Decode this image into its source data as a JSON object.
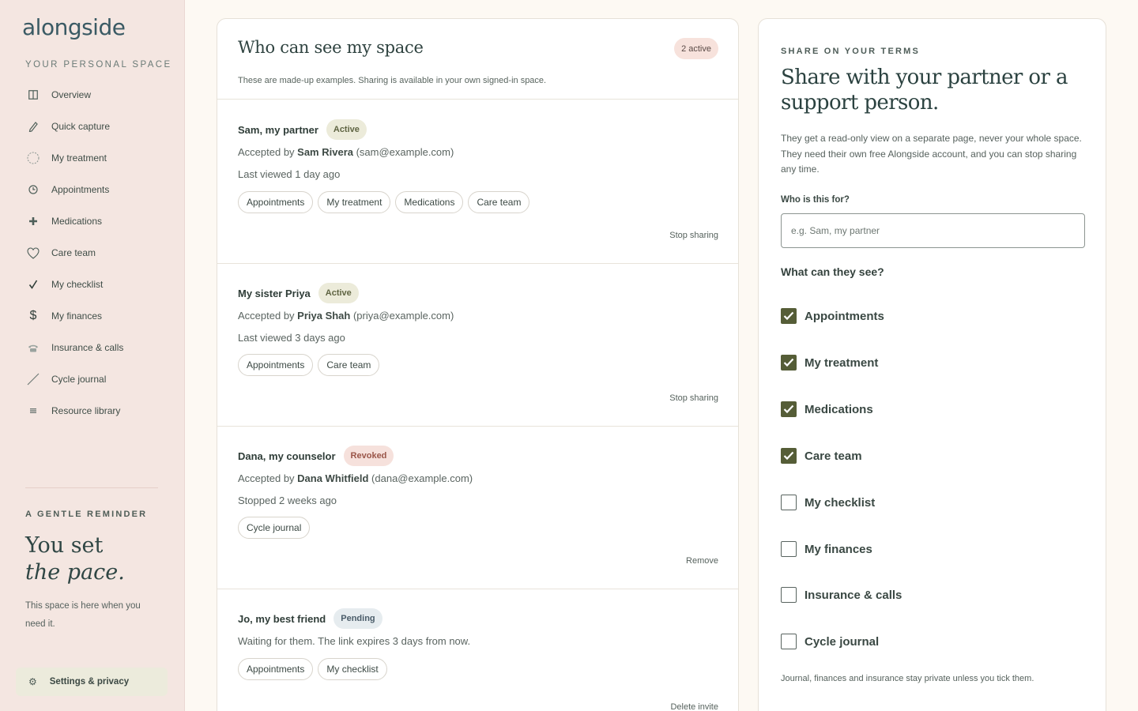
{
  "sidebar": {
    "brand": "alongside",
    "space_label": "YOUR PERSONAL SPACE",
    "items": [
      {
        "label": "Overview",
        "icon": "columns-icon"
      },
      {
        "label": "Quick capture",
        "icon": "pencil-icon"
      },
      {
        "label": "My treatment",
        "icon": "circle-icon"
      },
      {
        "label": "Appointments",
        "icon": "clock-icon"
      },
      {
        "label": "Medications",
        "icon": "plus-icon"
      },
      {
        "label": "Care team",
        "icon": "heart-icon"
      },
      {
        "label": "My checklist",
        "icon": "check-icon"
      },
      {
        "label": "My finances",
        "icon": "dollar-icon"
      },
      {
        "label": "Insurance & calls",
        "icon": "phone-icon"
      },
      {
        "label": "Cycle journal",
        "icon": "arrow-up-right-icon"
      },
      {
        "label": "Resource library",
        "icon": "list-icon"
      }
    ],
    "reminder_label": "A GENTLE REMINDER",
    "reminder_title_1": "You set",
    "reminder_title_2": "the pace.",
    "reminder_text": "This space is here when you need it.",
    "settings_label": "Settings & privacy",
    "settings_icon": "gear-icon"
  },
  "main": {
    "title": "Who can see my space",
    "count_badge": "2 active",
    "note": "These are made-up examples. Sharing is available in your own signed-in space.",
    "entries": [
      {
        "name": "Sam, my partner",
        "status": "Active",
        "accepted_prefix": "Accepted by ",
        "accepted_name": "Sam Rivera",
        "accepted_email": " (sam@example.com)",
        "last_line": "Last viewed 1 day ago",
        "chips": [
          "Appointments",
          "My treatment",
          "Medications",
          "Care team"
        ],
        "action": "Stop sharing"
      },
      {
        "name": "My sister Priya",
        "status": "Active",
        "accepted_prefix": "Accepted by ",
        "accepted_name": "Priya Shah",
        "accepted_email": " (priya@example.com)",
        "last_line": "Last viewed 3 days ago",
        "chips": [
          "Appointments",
          "Care team"
        ],
        "action": "Stop sharing"
      },
      {
        "name": "Dana, my counselor",
        "status": "Revoked",
        "accepted_prefix": "Accepted by ",
        "accepted_name": "Dana Whitfield",
        "accepted_email": " (dana@example.com)",
        "last_line": "Stopped 2 weeks ago",
        "chips": [
          "Cycle journal"
        ],
        "action": "Remove"
      },
      {
        "name": "Jo, my best friend",
        "status": "Pending",
        "waiting_line": "Waiting for them. The link expires 3 days from now.",
        "chips": [
          "Appointments",
          "My checklist"
        ],
        "action": "Delete invite"
      }
    ]
  },
  "share_panel": {
    "eyebrow": "SHARE ON YOUR TERMS",
    "title": "Share with your partner or a support person.",
    "description": "They get a read-only view on a separate page, never your whole space. They need their own free Alongside account, and you can stop sharing any time.",
    "who_label": "Who is this for?",
    "who_placeholder": "e.g. Sam, my partner",
    "what_label": "What can they see?",
    "options": [
      {
        "label": "Appointments",
        "checked": true
      },
      {
        "label": "My treatment",
        "checked": true
      },
      {
        "label": "Medications",
        "checked": true
      },
      {
        "label": "Care team",
        "checked": true
      },
      {
        "label": "My checklist",
        "checked": false
      },
      {
        "label": "My finances",
        "checked": false
      },
      {
        "label": "Insurance & calls",
        "checked": false
      },
      {
        "label": "Cycle journal",
        "checked": false
      }
    ],
    "footnote": "Journal, finances and insurance stay private unless you tick them."
  }
}
